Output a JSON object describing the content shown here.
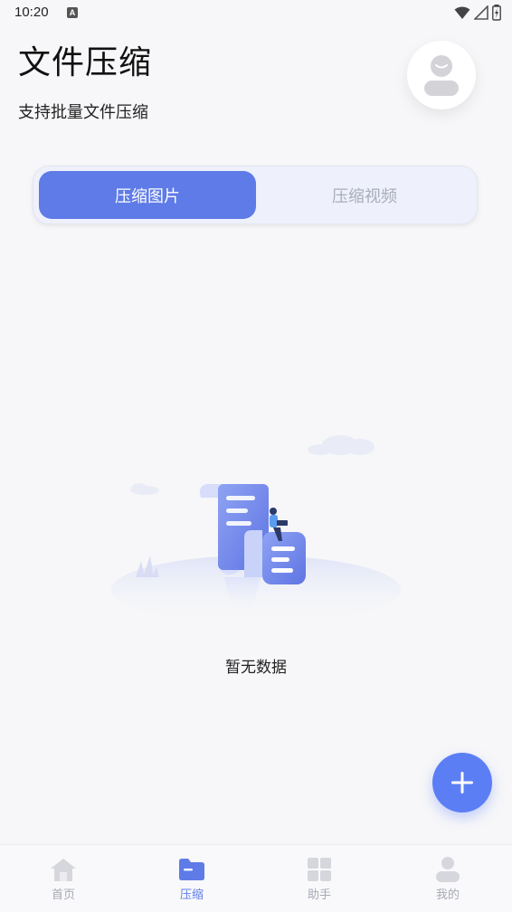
{
  "status_bar": {
    "time": "10:20",
    "a_badge": "A"
  },
  "header": {
    "title": "文件压缩",
    "subtitle": "支持批量文件压缩"
  },
  "tabs": [
    {
      "label": "压缩图片",
      "active": true
    },
    {
      "label": "压缩视频",
      "active": false
    }
  ],
  "empty_state": {
    "text": "暂无数据"
  },
  "fab": {
    "icon": "plus-icon"
  },
  "bottom_nav": [
    {
      "label": "首页",
      "icon": "home-icon",
      "active": false
    },
    {
      "label": "压缩",
      "icon": "folder-icon",
      "active": true
    },
    {
      "label": "助手",
      "icon": "grid-icon",
      "active": false
    },
    {
      "label": "我的",
      "icon": "person-icon",
      "active": false
    }
  ],
  "colors": {
    "accent": "#5e7be8",
    "fab": "#5b7ef5",
    "inactive": "#a7aab4",
    "background": "#f7f7f9"
  }
}
